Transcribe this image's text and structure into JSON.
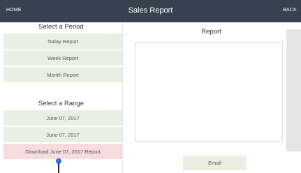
{
  "header": {
    "home": "HOME",
    "title": "Sales Report",
    "back": "BACK"
  },
  "period": {
    "heading": "Select a Period",
    "items": [
      "Today Report",
      "Week Report",
      "Month Report"
    ]
  },
  "range": {
    "heading": "Select a Range",
    "from": "June 07, 2017",
    "to": "June 07, 2017",
    "download": "Download June 07, 2017 Report"
  },
  "report": {
    "heading": "Report",
    "email": "Email"
  },
  "colors": {
    "topbar": "#384150",
    "button": "#e9f0e3",
    "download": "#f6dcdc",
    "cursor": "#2672d8"
  }
}
